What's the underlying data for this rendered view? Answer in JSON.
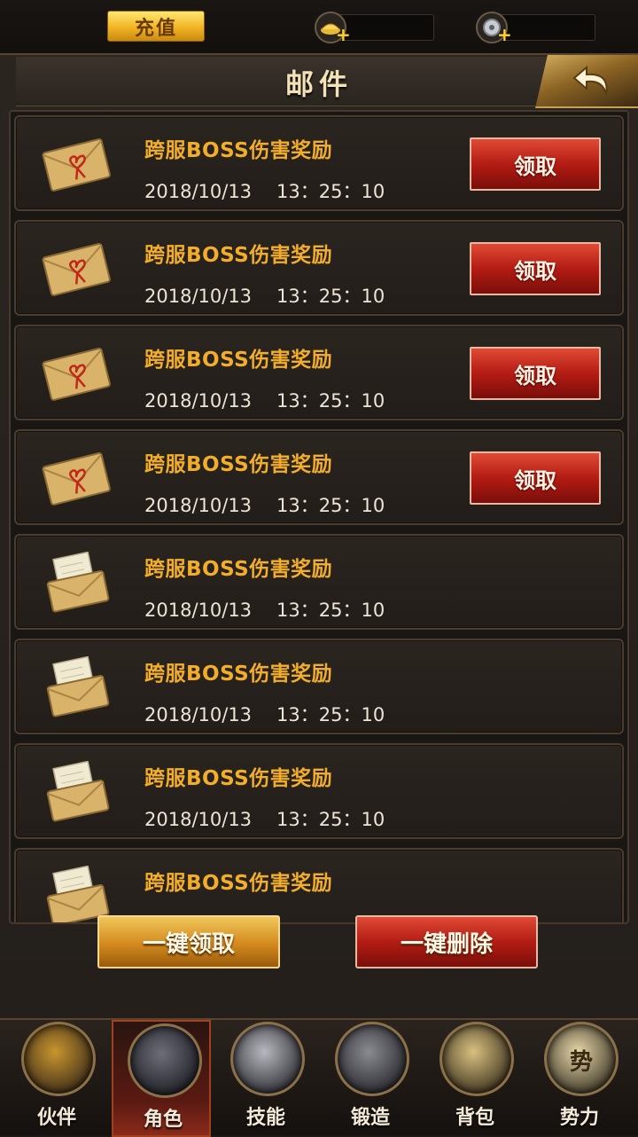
{
  "topbar": {
    "recharge_label": "充值",
    "gold_value": "",
    "silver_value": ""
  },
  "header": {
    "title": "邮件"
  },
  "mails": [
    {
      "subject": "跨服BOSS伤害奖励",
      "date": "2018/10/13",
      "time": "13：25：10",
      "claim_label": "领取",
      "claimable": true
    },
    {
      "subject": "跨服BOSS伤害奖励",
      "date": "2018/10/13",
      "time": "13：25：10",
      "claim_label": "领取",
      "claimable": true
    },
    {
      "subject": "跨服BOSS伤害奖励",
      "date": "2018/10/13",
      "time": "13：25：10",
      "claim_label": "领取",
      "claimable": true
    },
    {
      "subject": "跨服BOSS伤害奖励",
      "date": "2018/10/13",
      "time": "13：25：10",
      "claim_label": "领取",
      "claimable": true
    },
    {
      "subject": "跨服BOSS伤害奖励",
      "date": "2018/10/13",
      "time": "13：25：10",
      "claim_label": "",
      "claimable": false
    },
    {
      "subject": "跨服BOSS伤害奖励",
      "date": "2018/10/13",
      "time": "13：25：10",
      "claim_label": "",
      "claimable": false
    },
    {
      "subject": "跨服BOSS伤害奖励",
      "date": "2018/10/13",
      "time": "13：25：10",
      "claim_label": "",
      "claimable": false
    },
    {
      "subject": "跨服BOSS伤害奖励",
      "date": "",
      "time": "",
      "claim_label": "",
      "claimable": false
    }
  ],
  "actions": {
    "claim_all": "一键领取",
    "delete_all": "一键删除"
  },
  "nav": [
    {
      "label": "伙伴",
      "icon": "partner-icon",
      "active": false
    },
    {
      "label": "角色",
      "icon": "character-icon",
      "active": true
    },
    {
      "label": "技能",
      "icon": "skill-icon",
      "active": false
    },
    {
      "label": "锻造",
      "icon": "forge-icon",
      "active": false
    },
    {
      "label": "背包",
      "icon": "bag-icon",
      "active": false
    },
    {
      "label": "势力",
      "icon": "faction-icon",
      "active": false
    }
  ],
  "nav_glyph_faction": "势",
  "colors": {
    "subject": "#f2ad2a",
    "accent_gold": "#f0b424",
    "accent_red": "#b31c14"
  }
}
